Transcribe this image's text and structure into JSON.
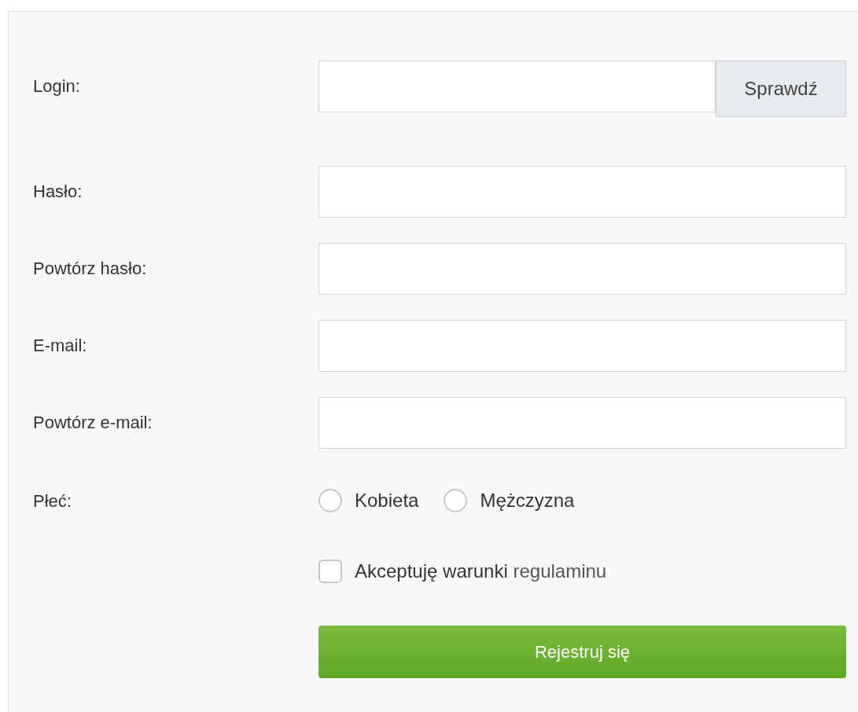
{
  "fields": [
    {
      "label": "Login:",
      "kind": "input_with_button",
      "button": "Sprawdź"
    },
    {
      "label": "Hasło:",
      "kind": "input"
    },
    {
      "label": "Powtórz hasło:",
      "kind": "input"
    },
    {
      "label": "E-mail:",
      "kind": "input"
    },
    {
      "label": "Powtórz e-mail:",
      "kind": "input"
    }
  ],
  "gender": {
    "label": "Płeć:",
    "options": [
      {
        "label": "Kobieta",
        "selected": false
      },
      {
        "label": "Mężczyzna",
        "selected": false
      }
    ]
  },
  "terms": {
    "text": "Akceptuję warunki",
    "link": "regulaminu",
    "checked": false
  },
  "submit": "Rejestruj się"
}
